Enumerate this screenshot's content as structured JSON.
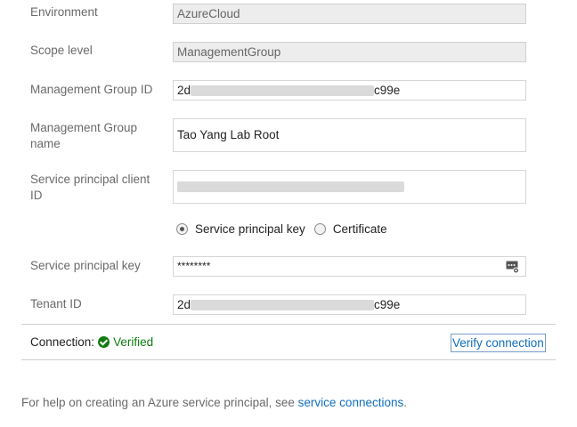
{
  "form": {
    "environment_label": "Environment",
    "environment_value": "AzureCloud",
    "scope_label": "Scope level",
    "scope_value": "ManagementGroup",
    "mgid_label": "Management Group ID",
    "mgid_prefix": "2d",
    "mgid_suffix": "c99e",
    "mgname_label": "Management Group name",
    "mgname_value": "Tao Yang Lab Root",
    "client_id_label": "Service principal client ID",
    "auth_options": [
      "Service principal key",
      "Certificate"
    ],
    "auth_selected": "Service principal key",
    "key_label": "Service principal key",
    "key_value": "********",
    "tenant_label": "Tenant ID",
    "tenant_prefix": "2d",
    "tenant_suffix": "c99e"
  },
  "connection": {
    "label": "Connection:",
    "status": "Verified",
    "status_color": "#107c10",
    "verify_button": "Verify connection"
  },
  "help": {
    "text": "For help on creating an Azure service principal, see ",
    "link": "service connections",
    "period": "."
  }
}
